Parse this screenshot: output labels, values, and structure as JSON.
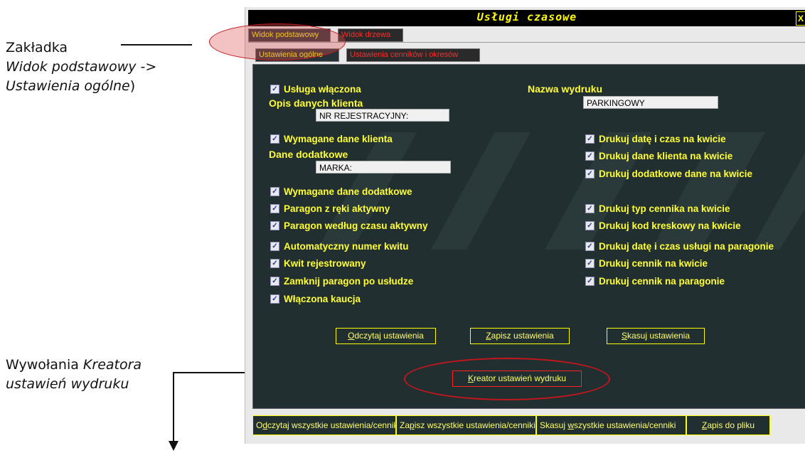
{
  "annotations": {
    "tab_line1": "Zakładka",
    "tab_line2_italic": "Widok podstawowy",
    "tab_line2_rest": " ->",
    "tab_line3_italic": "Ustawienia ogólne",
    "tab_line3_rest": ")",
    "creator_line1_plain": "Wywołania ",
    "creator_line1_italic": "Kreatora",
    "creator_line2_italic": "ustawień wydruku"
  },
  "window": {
    "title": "Usługi czasowe",
    "close_label": "X"
  },
  "tabs_top": [
    {
      "label": "Widok podstawowy",
      "active": true
    },
    {
      "label": "Widok drzewa",
      "active": false
    }
  ],
  "tabs_sub": [
    {
      "label": "Ustawienia ogólne",
      "active": true
    },
    {
      "label": "Ustawienia cenników i okresów",
      "active": false
    }
  ],
  "left": {
    "service_enabled": "Usługa włączona",
    "client_desc_label": "Opis danych klienta",
    "client_desc_value": "NR REJESTRACYJNY:",
    "client_required": "Wymagane dane klienta",
    "extra_label": "Dane dodatkowe",
    "extra_value": "MARKA:",
    "checks": [
      "Wymagane dane dodatkowe",
      "Paragon z ręki aktywny",
      "Paragon według czasu aktywny",
      "Automatyczny numer kwitu",
      "Kwit rejestrowany",
      "Zamknij paragon po usłudze",
      "Włączona kaucja"
    ]
  },
  "right": {
    "print_name_label": "Nazwa wydruku",
    "print_name_value": "PARKINGOWY",
    "checks": [
      "Drukuj datę i czas na kwicie",
      "Drukuj dane klienta na kwicie",
      "Drukuj dodatkowe dane na kwicie",
      "Drukuj typ cennika na kwicie",
      "Drukuj kod kreskowy na kwicie",
      "Drukuj datę i czas usługi na paragonie",
      "Drukuj cennik na kwicie",
      "Drukuj cennik na paragonie"
    ]
  },
  "buttons": {
    "read_first": "O",
    "read_rest": "dczytaj ustawienia",
    "save_first": "Z",
    "save_rest": "apisz ustawienia",
    "delete_first": "S",
    "delete_rest": "kasuj ustawienia",
    "creator_first": "K",
    "creator_rest": "reator ustawień wydruku"
  },
  "bottom_buttons": [
    {
      "pre": "O",
      "u": "d",
      "post": "czytaj wszystkie ustawienia/cenniki"
    },
    {
      "pre": "Za",
      "u": "p",
      "post": "isz wszystkie ustawienia/cenniki"
    },
    {
      "pre": "Skasuj ",
      "u": "w",
      "post": "szystkie ustawienia/cenniki"
    },
    {
      "pre": "",
      "u": "Z",
      "post": "apis do pliku"
    }
  ],
  "checkbox_mark": "✓",
  "colors": {
    "panel_bg": "#222f30",
    "label_yellow": "#ffff33",
    "inactive_tab_red": "#ff2a2a",
    "highlight_red": "#c4161c"
  }
}
